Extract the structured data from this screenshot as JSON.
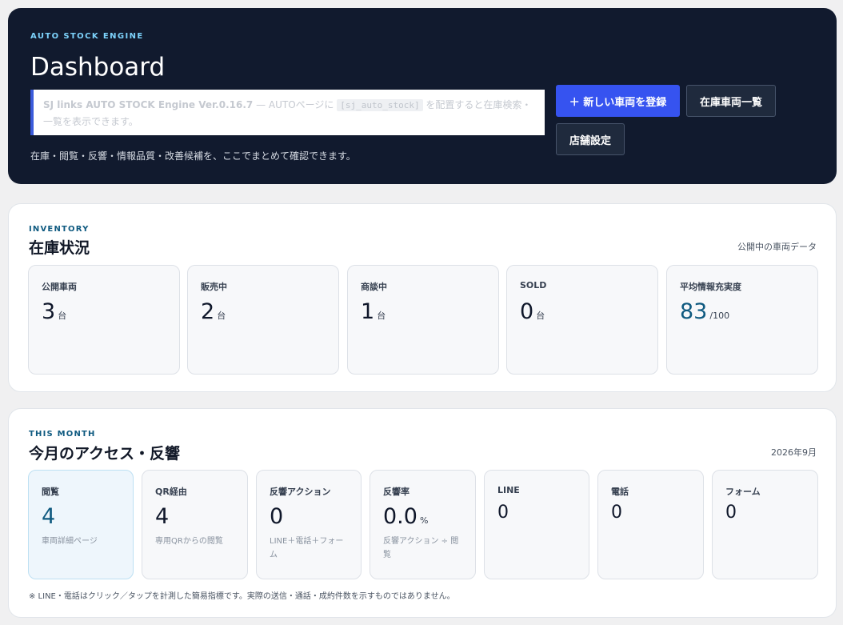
{
  "hero": {
    "eyebrow": "AUTO STOCK ENGINE",
    "title": "Dashboard",
    "notice_prefix": "SJ links AUTO STOCK Engine Ver.0.16.7",
    "notice_mid": " — AUTOページに ",
    "notice_code": "[sj_auto_stock]",
    "notice_suffix": " を配置すると在庫検索・一覧を表示できます。",
    "description": "在庫・閲覧・反響・情報品質・改善候補を、ここでまとめて確認できます。",
    "buttons": {
      "new_vehicle": "＋ 新しい車両を登録",
      "inventory_list": "在庫車両一覧",
      "store_settings": "店舗設定"
    }
  },
  "inventory": {
    "eyebrow": "INVENTORY",
    "title": "在庫状況",
    "meta": "公開中の車両データ",
    "cards": [
      {
        "label": "公開車両",
        "value": "3",
        "unit": "台"
      },
      {
        "label": "販売中",
        "value": "2",
        "unit": "台"
      },
      {
        "label": "商談中",
        "value": "1",
        "unit": "台"
      },
      {
        "label": "SOLD",
        "value": "0",
        "unit": "台"
      },
      {
        "label": "平均情報充実度",
        "value": "83",
        "unit": "/100"
      }
    ]
  },
  "month": {
    "eyebrow": "THIS MONTH",
    "title": "今月のアクセス・反響",
    "meta": "2026年9月",
    "cards": [
      {
        "label": "閲覧",
        "value": "4",
        "sub": "車両詳細ページ"
      },
      {
        "label": "QR経由",
        "value": "4",
        "sub": "専用QRからの閲覧"
      },
      {
        "label": "反響アクション",
        "value": "0",
        "sub": "LINE＋電話＋フォーム"
      },
      {
        "label": "反響率",
        "value": "0.0",
        "unit": "%",
        "sub": "反響アクション ÷ 閲覧"
      },
      {
        "label": "LINE",
        "value": "0"
      },
      {
        "label": "電話",
        "value": "0"
      },
      {
        "label": "フォーム",
        "value": "0"
      }
    ],
    "footnote": "※ LINE・電話はクリック／タップを計測した簡易指標です。実際の送信・通話・成約件数を示すものではありません。"
  },
  "colors": {
    "hero_bg": "#111a2e",
    "primary_button": "#3653f0",
    "accent": "#0f5a80",
    "eyebrow_hero": "#7dd3fc"
  }
}
